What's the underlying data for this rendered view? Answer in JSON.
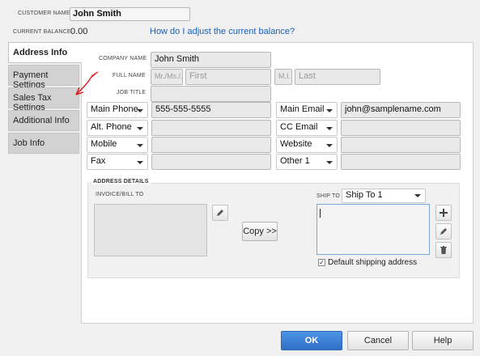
{
  "header": {
    "customer_name_label": "CUSTOMER NAME",
    "customer_name_value": "John Smith",
    "current_balance_label": "CURRENT BALANCE",
    "current_balance_value": "0.00",
    "adjust_link": "How do I adjust the current balance?"
  },
  "tabs": [
    {
      "label": "Address Info",
      "active": true
    },
    {
      "label": "Payment Settings"
    },
    {
      "label": "Sales Tax Settings"
    },
    {
      "label": "Additional Info"
    },
    {
      "label": "Job Info"
    }
  ],
  "form": {
    "company_label": "COMPANY NAME",
    "company_value": "John Smith",
    "full_name_label": "FULL NAME",
    "title_placeholder": "Mr./Ms./...",
    "first_placeholder": "First",
    "mi_placeholder": "M.I.",
    "last_placeholder": "Last",
    "job_title_label": "JOB TITLE",
    "job_title_value": "",
    "phones": [
      {
        "type": "Main Phone",
        "value": "555-555-5555"
      },
      {
        "type": "Alt. Phone",
        "value": ""
      },
      {
        "type": "Mobile",
        "value": ""
      },
      {
        "type": "Fax",
        "value": ""
      }
    ],
    "contacts": [
      {
        "type": "Main Email",
        "value": "john@samplename.com"
      },
      {
        "type": "CC Email",
        "value": ""
      },
      {
        "type": "Website",
        "value": ""
      },
      {
        "type": "Other 1",
        "value": ""
      }
    ]
  },
  "address": {
    "section_label": "ADDRESS DETAILS",
    "invoice_label": "INVOICE/BILL TO",
    "ship_label": "SHIP TO",
    "ship_select": "Ship To 1",
    "copy_button": "Copy >>",
    "default_shipping_label": "Default shipping address",
    "default_shipping_checked": true
  },
  "footer": {
    "ok": "OK",
    "cancel": "Cancel",
    "help": "Help"
  },
  "colors": {
    "link": "#1a5fb4",
    "ok_button": "#3d7fd6",
    "annotation": "#e01818"
  }
}
